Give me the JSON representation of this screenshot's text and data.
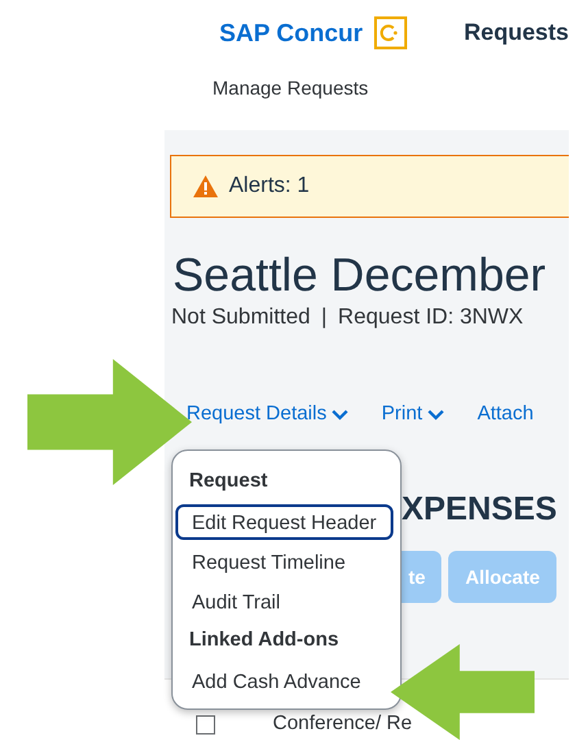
{
  "header": {
    "brand": "SAP Concur",
    "nav_title": "Requests"
  },
  "subnav": {
    "label": "Manage Requests"
  },
  "alert": {
    "text": "Alerts: 1"
  },
  "request": {
    "title": "Seattle December",
    "status": "Not Submitted",
    "separator": "|",
    "request_id": "Request ID: 3NWX"
  },
  "tabs": [
    {
      "label": "Request Details",
      "dropdown": true
    },
    {
      "label": "Print",
      "dropdown": true
    },
    {
      "label": "Attach",
      "dropdown": false
    }
  ],
  "menu": {
    "items": [
      {
        "kind": "header",
        "label": "Request"
      },
      {
        "kind": "item",
        "label": "Edit Request Header",
        "focused": true
      },
      {
        "kind": "item",
        "label": "Request Timeline",
        "focused": false
      },
      {
        "kind": "item",
        "label": "Audit Trail",
        "focused": false
      },
      {
        "kind": "header",
        "label": "Linked Add-ons"
      },
      {
        "kind": "item",
        "label": "Add Cash Advance",
        "focused": false
      }
    ]
  },
  "section": {
    "heading": "XPENSES"
  },
  "buttons": [
    "te",
    "Allocate"
  ],
  "table": {
    "rows": [
      {
        "checked": false,
        "text": "Conference/ Re"
      }
    ]
  },
  "annotations": [
    {
      "kind": "arrow-right"
    },
    {
      "kind": "arrow-left"
    }
  ]
}
